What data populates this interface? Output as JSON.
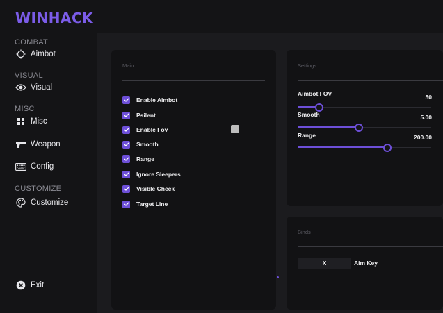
{
  "brand": "WINHACK",
  "accent_color": "#6d4fd8",
  "sidebar": {
    "sections": [
      {
        "label": "COMBAT",
        "items": [
          {
            "label": "Aimbot",
            "icon": "crosshair-icon"
          }
        ]
      },
      {
        "label": "VISUAL",
        "items": [
          {
            "label": "Visual",
            "icon": "eye-icon"
          }
        ]
      },
      {
        "label": "MISC",
        "items": [
          {
            "label": "Misc",
            "icon": "grid-icon"
          },
          {
            "label": "Weapon",
            "icon": "gun-icon"
          },
          {
            "label": "Config",
            "icon": "keyboard-icon"
          }
        ]
      },
      {
        "label": "CUSTOMIZE",
        "items": [
          {
            "label": "Customize",
            "icon": "palette-icon"
          }
        ]
      }
    ],
    "exit_label": "Exit"
  },
  "main_panel": {
    "title": "Main",
    "checkboxes": [
      {
        "label": "Enable Aimbot",
        "checked": true
      },
      {
        "label": "Psilent",
        "checked": true
      },
      {
        "label": "Enable Fov",
        "checked": true
      },
      {
        "label": "Smooth",
        "checked": true
      },
      {
        "label": "Range",
        "checked": true
      },
      {
        "label": "Ignore Sleepers",
        "checked": true
      },
      {
        "label": "Visible Check",
        "checked": true
      },
      {
        "label": "Target Line",
        "checked": true
      }
    ],
    "fov_color": "#bdbdbd"
  },
  "settings_panel": {
    "title": "Settings",
    "sliders": [
      {
        "label": "Aimbot FOV",
        "value": "50",
        "fill": 0.16
      },
      {
        "label": "Smooth",
        "value": "5.00",
        "fill": 0.46
      },
      {
        "label": "Range",
        "value": "200.00",
        "fill": 0.67
      }
    ]
  },
  "binds_panel": {
    "title": "Binds",
    "key": "X",
    "key_label": "Aim Key"
  }
}
